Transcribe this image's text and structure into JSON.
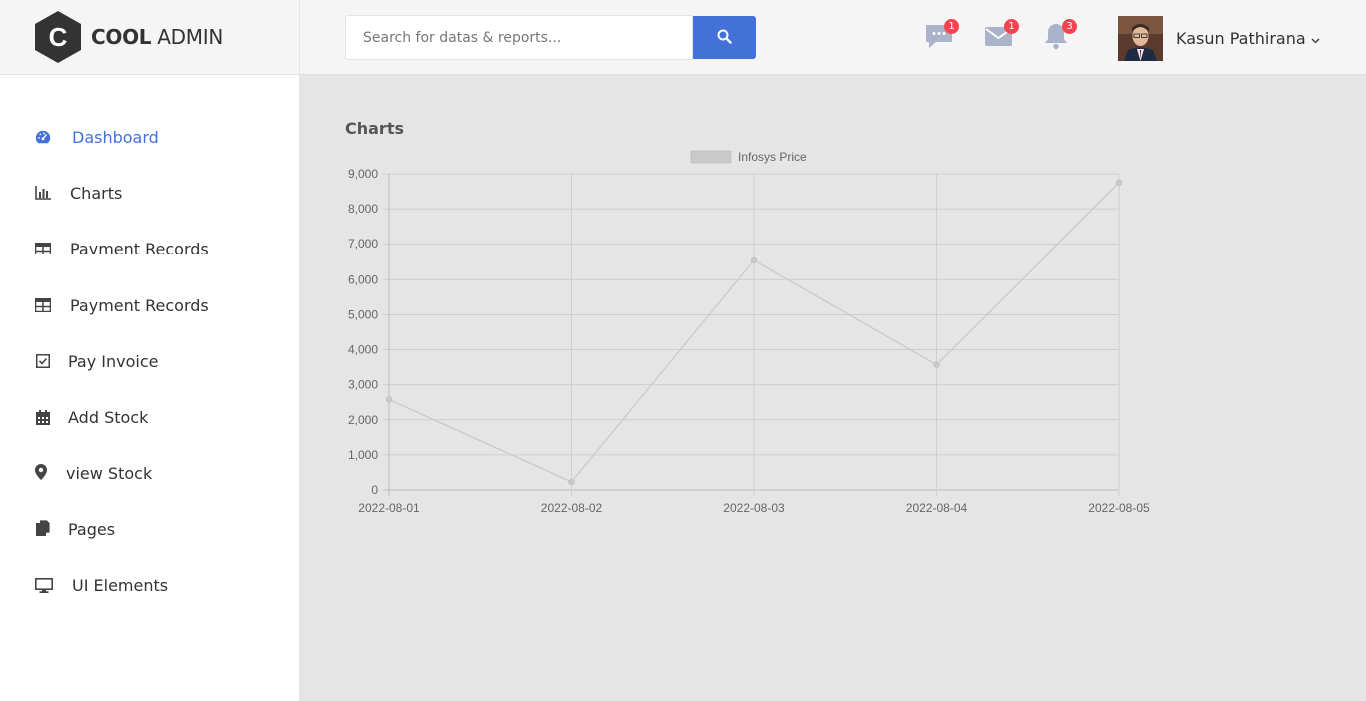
{
  "brand": {
    "bold": "COOL",
    "light": "ADMIN",
    "letter": "C"
  },
  "search": {
    "placeholder": "Search for datas & reports..."
  },
  "header": {
    "chat_badge": "1",
    "mail_badge": "1",
    "notif_badge": "3",
    "user_name": "Kasun Pathirana"
  },
  "sidebar": {
    "items": [
      {
        "label": "Dashboard",
        "icon": "dashboard-icon"
      },
      {
        "label": "Charts",
        "icon": "bar-chart-icon"
      },
      {
        "label": "Payment Records",
        "icon": "table-icon"
      },
      {
        "label": "Payment Records",
        "icon": "table-icon"
      },
      {
        "label": "Pay Invoice",
        "icon": "checkbox-icon"
      },
      {
        "label": "Add Stock",
        "icon": "calendar-icon"
      },
      {
        "label": "view Stock",
        "icon": "map-marker-icon"
      },
      {
        "label": "Pages",
        "icon": "copy-icon"
      },
      {
        "label": "UI Elements",
        "icon": "desktop-icon"
      }
    ]
  },
  "main": {
    "title": "Charts"
  },
  "colors": {
    "accent": "#4272d7",
    "badge": "#fa4251",
    "line": "#c9c9c9"
  },
  "chart_data": {
    "type": "line",
    "categories": [
      "2022-08-01",
      "2022-08-02",
      "2022-08-03",
      "2022-08-04",
      "2022-08-05"
    ],
    "series": [
      {
        "name": "Infosys Price",
        "values": [
          2580,
          230,
          6550,
          3570,
          8750
        ]
      }
    ],
    "ylim": [
      0,
      9000
    ],
    "yticks": [
      "0",
      "1,000",
      "2,000",
      "3,000",
      "4,000",
      "5,000",
      "6,000",
      "7,000",
      "8,000",
      "9,000"
    ],
    "grid": true,
    "legend": "top-center"
  }
}
